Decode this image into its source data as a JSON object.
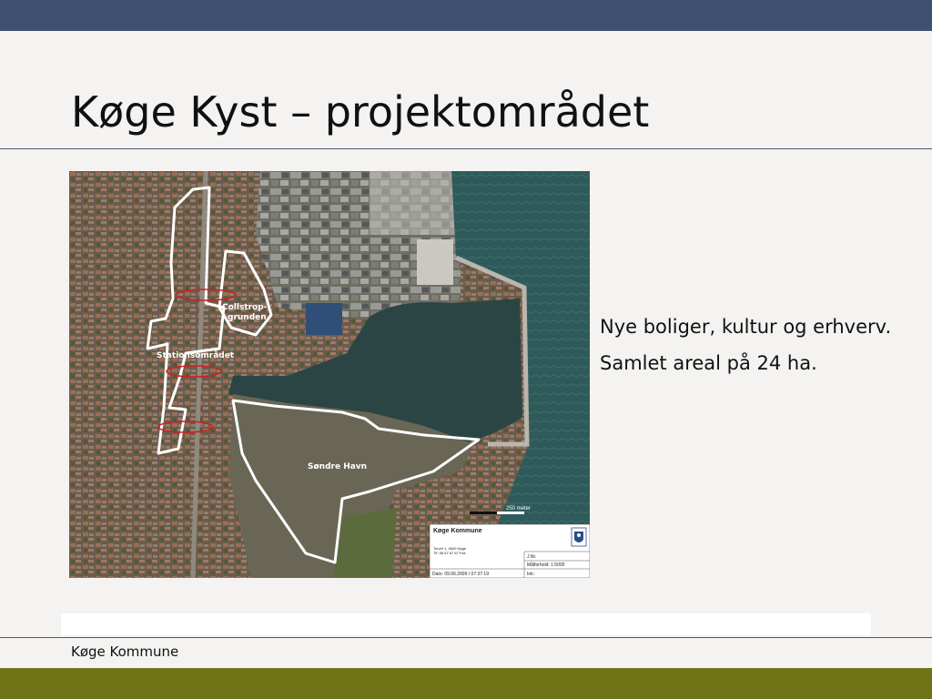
{
  "slide": {
    "title": "Køge Kyst – projektområdet",
    "footer": "Køge Kommune"
  },
  "bullets": [
    "Nye boliger, kultur og erhverv.",
    "Samlet areal på 24 ha."
  ],
  "map": {
    "labels": {
      "collstrop_1": "Collstrop-",
      "collstrop_2": "grunden",
      "station": "Stationsområdet",
      "sondre": "Søndre Havn"
    },
    "scale_label": "250 meter",
    "legend": {
      "org": "Køge Kommune",
      "address_1": "Torvet 1, 4600 Køge",
      "address_2": "Tlf. 56 67 67 67 Fax",
      "jnr": "J.Nr.",
      "scale": "Målforhold: 1:5000",
      "date": "Dato: 09.06.2009 / 07:37:19",
      "init": "Init.:"
    }
  },
  "colors": {
    "top_bar": "#3e5270",
    "bottom_bar": "#6f7417",
    "water": "#2e4a48",
    "outline": "#ffffff",
    "marker": "#d02020"
  }
}
